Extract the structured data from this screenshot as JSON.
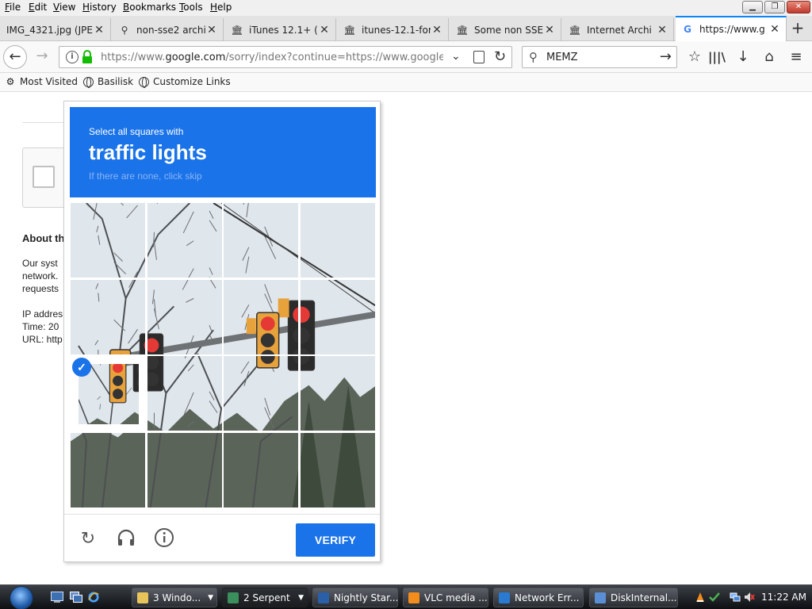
{
  "menubar": {
    "items": [
      {
        "label": "File",
        "u": "F",
        "rest": "ile"
      },
      {
        "label": "Edit",
        "u": "E",
        "rest": "dit"
      },
      {
        "label": "View",
        "u": "V",
        "rest": "iew"
      },
      {
        "label": "History",
        "u": "H",
        "rest": "istory"
      },
      {
        "label": "Bookmarks",
        "u": "B",
        "rest": "ookmarks"
      },
      {
        "label": "Tools",
        "u": "T",
        "rest": "ools"
      },
      {
        "label": "Help",
        "u": "H",
        "rest": "elp"
      }
    ]
  },
  "tabs": [
    {
      "title": "IMG_4321.jpg (JPE",
      "icon": "image-icon"
    },
    {
      "title": "non-sse2 archi",
      "icon": "search-icon"
    },
    {
      "title": "iTunes 12.1+ (f",
      "icon": "archive-icon"
    },
    {
      "title": "itunes-12.1-for",
      "icon": "archive-icon"
    },
    {
      "title": "Some non SSE",
      "icon": "archive-icon"
    },
    {
      "title": "Internet Archi",
      "icon": "archive-icon"
    },
    {
      "title": "https://www.g",
      "icon": "google-icon"
    }
  ],
  "navbar": {
    "url_prefix": "https://www.",
    "url_domain": "google.com",
    "url_rest": "/sorry/index?continue=https://www.google.cor",
    "search_value": "MEMZ"
  },
  "bookmarks": [
    {
      "label": "Most Visited"
    },
    {
      "label": "Basilisk"
    },
    {
      "label": "Customize Links"
    }
  ],
  "page": {
    "about_title": "About th",
    "lines": [
      "Our syst",
      "network.",
      "requests",
      "",
      "IP addres",
      "Time: 20",
      "URL: http"
    ]
  },
  "challenge": {
    "instruction": "Select all squares with",
    "target": "traffic lights",
    "hint": "If there are none, click skip",
    "verify_label": "VERIFY",
    "selected_tiles": [
      8
    ],
    "colors": {
      "accent": "#1a73e8"
    }
  },
  "taskbar": {
    "buttons": [
      {
        "label": "3 Windo...",
        "color": "#e8c55a",
        "has_arrow": true
      },
      {
        "label": "2 Serpent",
        "color": "#3a8f5c",
        "has_arrow": true
      },
      {
        "label": "Nightly Star...",
        "color": "#2b5fa8",
        "has_arrow": false
      },
      {
        "label": "VLC media ...",
        "color": "#f28c1c",
        "has_arrow": false
      },
      {
        "label": "Network Err...",
        "color": "#2a7ad1",
        "has_arrow": false
      },
      {
        "label": "DiskInternal...",
        "color": "#5a8fd6",
        "has_arrow": false
      }
    ],
    "clock": "11:22 AM"
  }
}
